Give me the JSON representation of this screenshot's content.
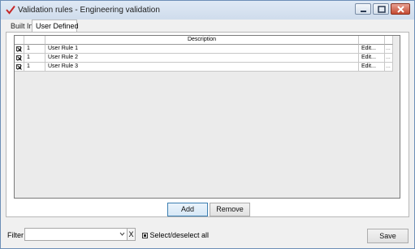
{
  "window": {
    "title": "Validation rules - Engineering validation",
    "accent_color": "#c62828"
  },
  "tabs": [
    {
      "label": "Built In",
      "active": false
    },
    {
      "label": "User Defined",
      "active": true
    }
  ],
  "grid": {
    "columns": {
      "description": "Description"
    },
    "rows": [
      {
        "checked": true,
        "number": "1",
        "description": "User Rule 1",
        "edit": "Edit...",
        "more": "..."
      },
      {
        "checked": true,
        "number": "1",
        "description": "User Rule 2",
        "edit": "Edit...",
        "more": "..."
      },
      {
        "checked": true,
        "number": "1",
        "description": "User Rule 3",
        "edit": "Edit...",
        "more": "..."
      }
    ]
  },
  "buttons": {
    "add": "Add",
    "remove": "Remove",
    "save": "Save"
  },
  "filter": {
    "label": "Filter",
    "value": "",
    "clear": "X"
  },
  "select_all": {
    "label": "Select/deselect all",
    "checked": true
  }
}
